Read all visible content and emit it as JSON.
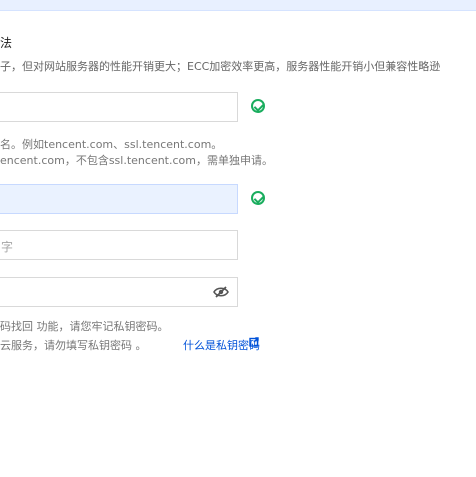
{
  "section": {
    "title": "法",
    "description": "子，但对网站服务器的性能开销更大；ECC加密效率更高，服务器性能开销小但兼容性略逊"
  },
  "domain_field": {
    "value": "",
    "hint_line1": "名。例如tencent.com、ssl.tencent.com。",
    "hint_line2": "encent.com，不包含ssl.tencent.com，需单独申请。"
  },
  "filled_field": {
    "value": ""
  },
  "text_field": {
    "placeholder": "字"
  },
  "password_field": {
    "value": "",
    "hint_line1": "码找回 功能，请您牢记私钥密码。",
    "hint_line2": "云服务，请勿填写私钥密码 。",
    "link_text": "什么是私钥密码"
  },
  "icons": {
    "check": "check-circle-icon",
    "eye": "eye-off-icon",
    "external": "external-link-icon"
  },
  "colors": {
    "success": "#1aad5e",
    "link": "#0052d9",
    "filled_bg": "#eaf2ff"
  }
}
